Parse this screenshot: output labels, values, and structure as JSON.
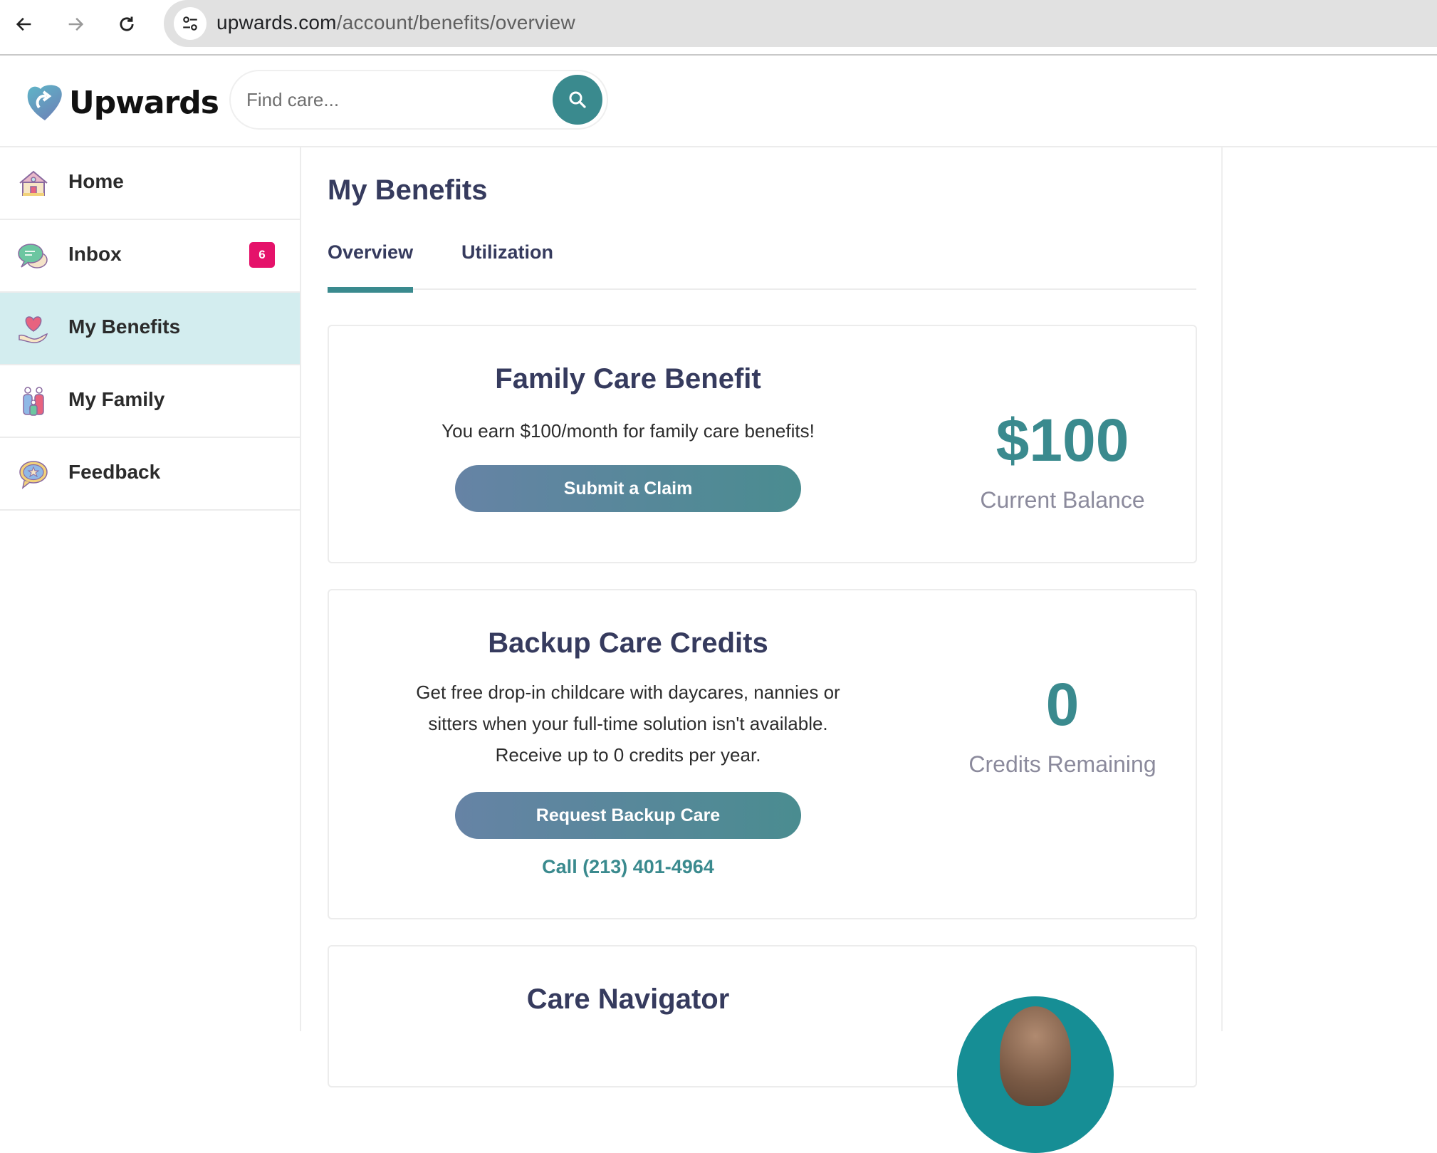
{
  "browser": {
    "url_host": "upwards.com",
    "url_path": "/account/benefits/overview",
    "back_icon": "arrow-left-icon",
    "forward_icon": "arrow-right-icon",
    "reload_icon": "reload-icon",
    "site_info_icon": "tune-icon"
  },
  "header": {
    "logo_text": "Upwards",
    "search": {
      "placeholder": "Find care...",
      "value": "",
      "icon": "search-icon"
    }
  },
  "sidebar": {
    "items": [
      {
        "label": "Home",
        "icon": "house-icon",
        "active": false
      },
      {
        "label": "Inbox",
        "icon": "chat-bubbles-icon",
        "active": false,
        "badge": "6"
      },
      {
        "label": "My Benefits",
        "icon": "heart-hand-icon",
        "active": true
      },
      {
        "label": "My Family",
        "icon": "family-icon",
        "active": false
      },
      {
        "label": "Feedback",
        "icon": "star-speech-bubble-icon",
        "active": false
      }
    ]
  },
  "main": {
    "title": "My Benefits",
    "tabs": [
      {
        "label": "Overview",
        "active": true
      },
      {
        "label": "Utilization",
        "active": false
      }
    ],
    "cards": {
      "family_care": {
        "title": "Family Care Benefit",
        "description": "You earn $100/month for family care benefits!",
        "button": "Submit a Claim",
        "value": "$100",
        "value_label": "Current Balance"
      },
      "backup_care": {
        "title": "Backup Care Credits",
        "description_lines": [
          "Get free drop-in childcare with daycares, nannies or",
          "sitters when your full-time solution isn't available.",
          "Receive up to 0 credits per year."
        ],
        "button": "Request Backup Care",
        "phone_link": "Call (213) 401-4964",
        "value": "0",
        "value_label": "Credits Remaining"
      },
      "care_navigator": {
        "title": "Care Navigator"
      }
    }
  },
  "colors": {
    "accent": "#3a8a8e",
    "active_sidebar_bg": "#d3edef",
    "badge": "#e5126a",
    "heading": "#363b5e",
    "button_gradient_start": "#6683a5",
    "button_gradient_end": "#4a8c90"
  }
}
